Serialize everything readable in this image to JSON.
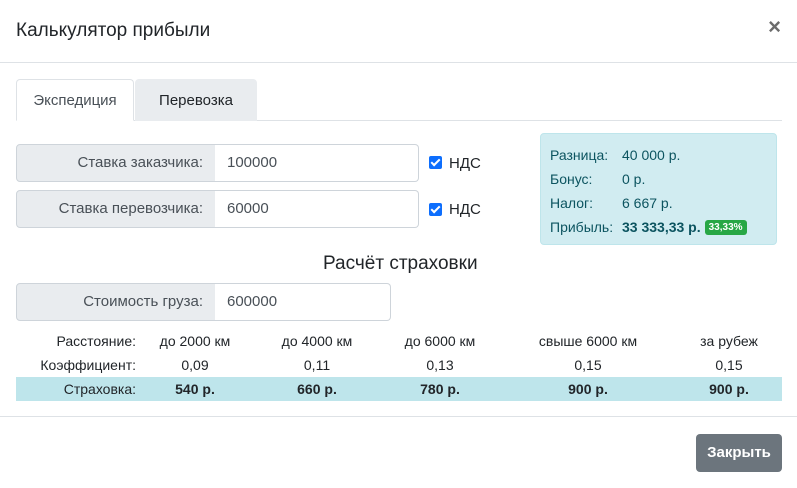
{
  "modal": {
    "title": "Калькулятор прибыли",
    "close_glyph": "×"
  },
  "tabs": [
    {
      "label": "Экспедиция",
      "active": true
    },
    {
      "label": "Перевозка",
      "active": false
    }
  ],
  "form": {
    "customer_rate": {
      "label": "Ставка заказчика:",
      "value": "100000",
      "vat_label": "НДС",
      "vat_checked": true
    },
    "carrier_rate": {
      "label": "Ставка перевозчика:",
      "value": "60000",
      "vat_label": "НДС",
      "vat_checked": true
    }
  },
  "summary": {
    "difference": {
      "label": "Разница:",
      "value": "40 000 р."
    },
    "bonus": {
      "label": "Бонус:",
      "value": "0 р."
    },
    "tax": {
      "label": "Налог:",
      "value": "6 667 р."
    },
    "profit": {
      "label": "Прибыль:",
      "value": "33 333,33 р.",
      "percent": "33,33%"
    }
  },
  "insurance": {
    "title": "Расчёт страховки",
    "cargo_value": {
      "label": "Стоимость груза:",
      "value": "600000"
    },
    "table": {
      "distance_label": "Расстояние:",
      "coef_label": "Коэффициент:",
      "insurance_label": "Страховка:",
      "columns": [
        {
          "distance": "до 2000 км",
          "coef": "0,09",
          "insurance": "540 р."
        },
        {
          "distance": "до 4000 км",
          "coef": "0,11",
          "insurance": "660 р."
        },
        {
          "distance": "до 6000 км",
          "coef": "0,13",
          "insurance": "780 р."
        },
        {
          "distance": "свыше 6000 км",
          "coef": "0,15",
          "insurance": "900 р."
        },
        {
          "distance": "за рубеж",
          "coef": "0,15",
          "insurance": "900 р."
        }
      ]
    }
  },
  "footer": {
    "close_button": "Закрыть"
  },
  "colors": {
    "accent": "#0d6efd",
    "info_bg": "#d1ecf1",
    "info_text": "#0c5460",
    "badge": "#28a745",
    "highlight_row": "#bee5eb",
    "secondary_button": "#6c757d"
  }
}
